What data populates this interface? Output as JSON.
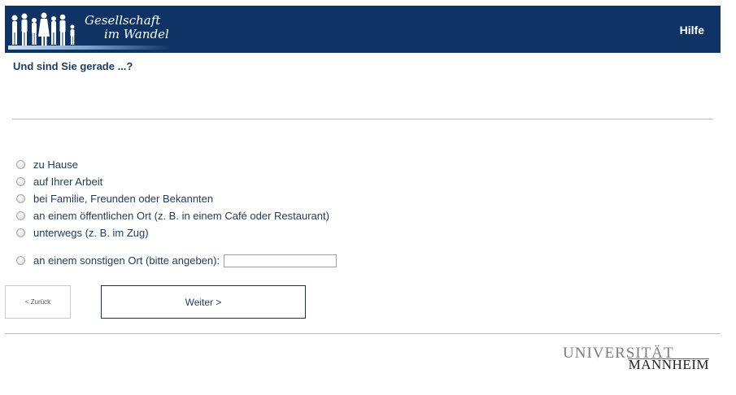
{
  "header": {
    "logo_line1": "Gesellschaft",
    "logo_line2": "im Wandel",
    "help_label": "Hilfe"
  },
  "question": "Und sind Sie gerade ...?",
  "options": [
    {
      "label": "zu Hause",
      "selected": false
    },
    {
      "label": "auf Ihrer Arbeit",
      "selected": false
    },
    {
      "label": "bei Familie, Freunden oder Bekannten",
      "selected": false
    },
    {
      "label": "an einem öffentlichen Ort (z. B. in einem Café oder Restaurant)",
      "selected": false
    },
    {
      "label": "unterwegs (z. B. im Zug)",
      "selected": false
    }
  ],
  "other_option": {
    "label": "an einem sonstigen Ort (bitte angeben):",
    "value": "",
    "selected": false
  },
  "buttons": {
    "back_label": "< Zurück",
    "next_label": "Weiter >"
  },
  "footer": {
    "university_line1": "UNIVERSITÄT",
    "university_line2": "MANNHEIM"
  },
  "colors": {
    "header_bg": "#0e3364",
    "text": "#1f3a5a",
    "divider": "#b9b9b9"
  }
}
